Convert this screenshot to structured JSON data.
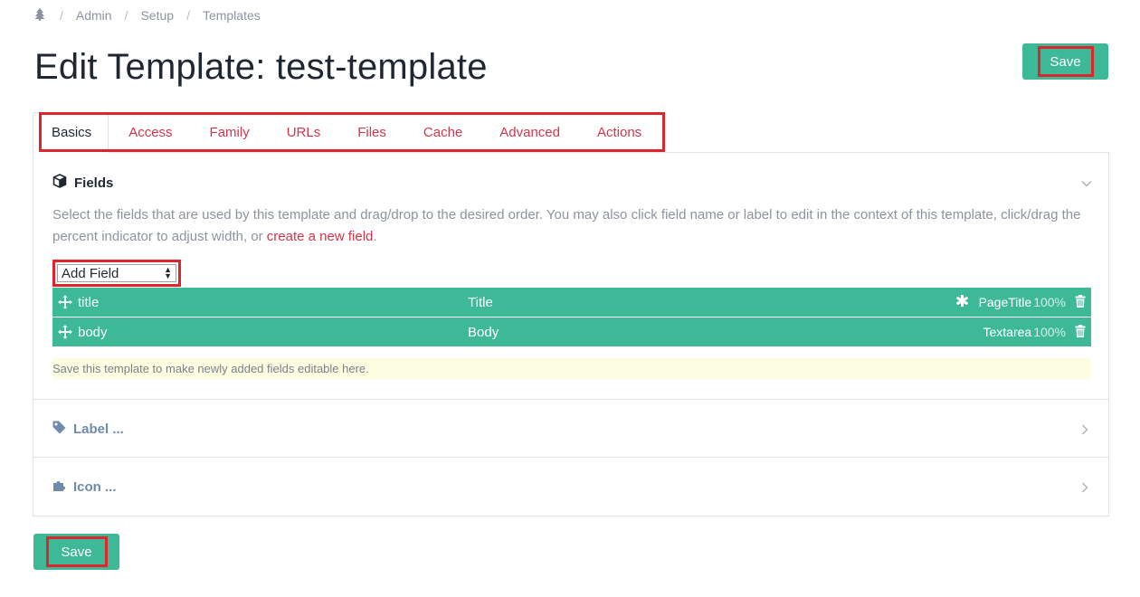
{
  "breadcrumb": {
    "home_icon": "tree-icon",
    "separator": "/",
    "items": [
      "Admin",
      "Setup",
      "Templates"
    ]
  },
  "page": {
    "title": "Edit Template: test-template"
  },
  "buttons": {
    "save_top": "Save",
    "save_bottom": "Save"
  },
  "tabs": [
    {
      "label": "Basics",
      "active": true
    },
    {
      "label": "Access"
    },
    {
      "label": "Family"
    },
    {
      "label": "URLs"
    },
    {
      "label": "Files"
    },
    {
      "label": "Cache"
    },
    {
      "label": "Advanced"
    },
    {
      "label": "Actions"
    }
  ],
  "fields_section": {
    "icon": "cube-icon",
    "title": "Fields",
    "description": "Select the fields that are used by this template and drag/drop to the desired order. You may also click field name or label to edit in the context of this template, click/drag the percent indicator to adjust width, or",
    "link": "create a new field",
    "period": ".",
    "add_field_select": "Add Field",
    "rows": [
      {
        "name": "title",
        "label": "Title",
        "type": "PageTitle",
        "width": "100%",
        "required": true
      },
      {
        "name": "body",
        "label": "Body",
        "type": "Textarea",
        "width": "100%",
        "required": false
      }
    ],
    "notice": "Save this template to make newly added fields editable here."
  },
  "label_section": {
    "icon": "tag-icon",
    "title": "Label ..."
  },
  "icon_section": {
    "icon": "puzzle-icon",
    "title": "Icon ..."
  },
  "colors": {
    "accent_green": "#3eb998",
    "link_red": "#d6344a",
    "highlight_red": "#e0242c",
    "notice_bg": "#fdfde1"
  }
}
